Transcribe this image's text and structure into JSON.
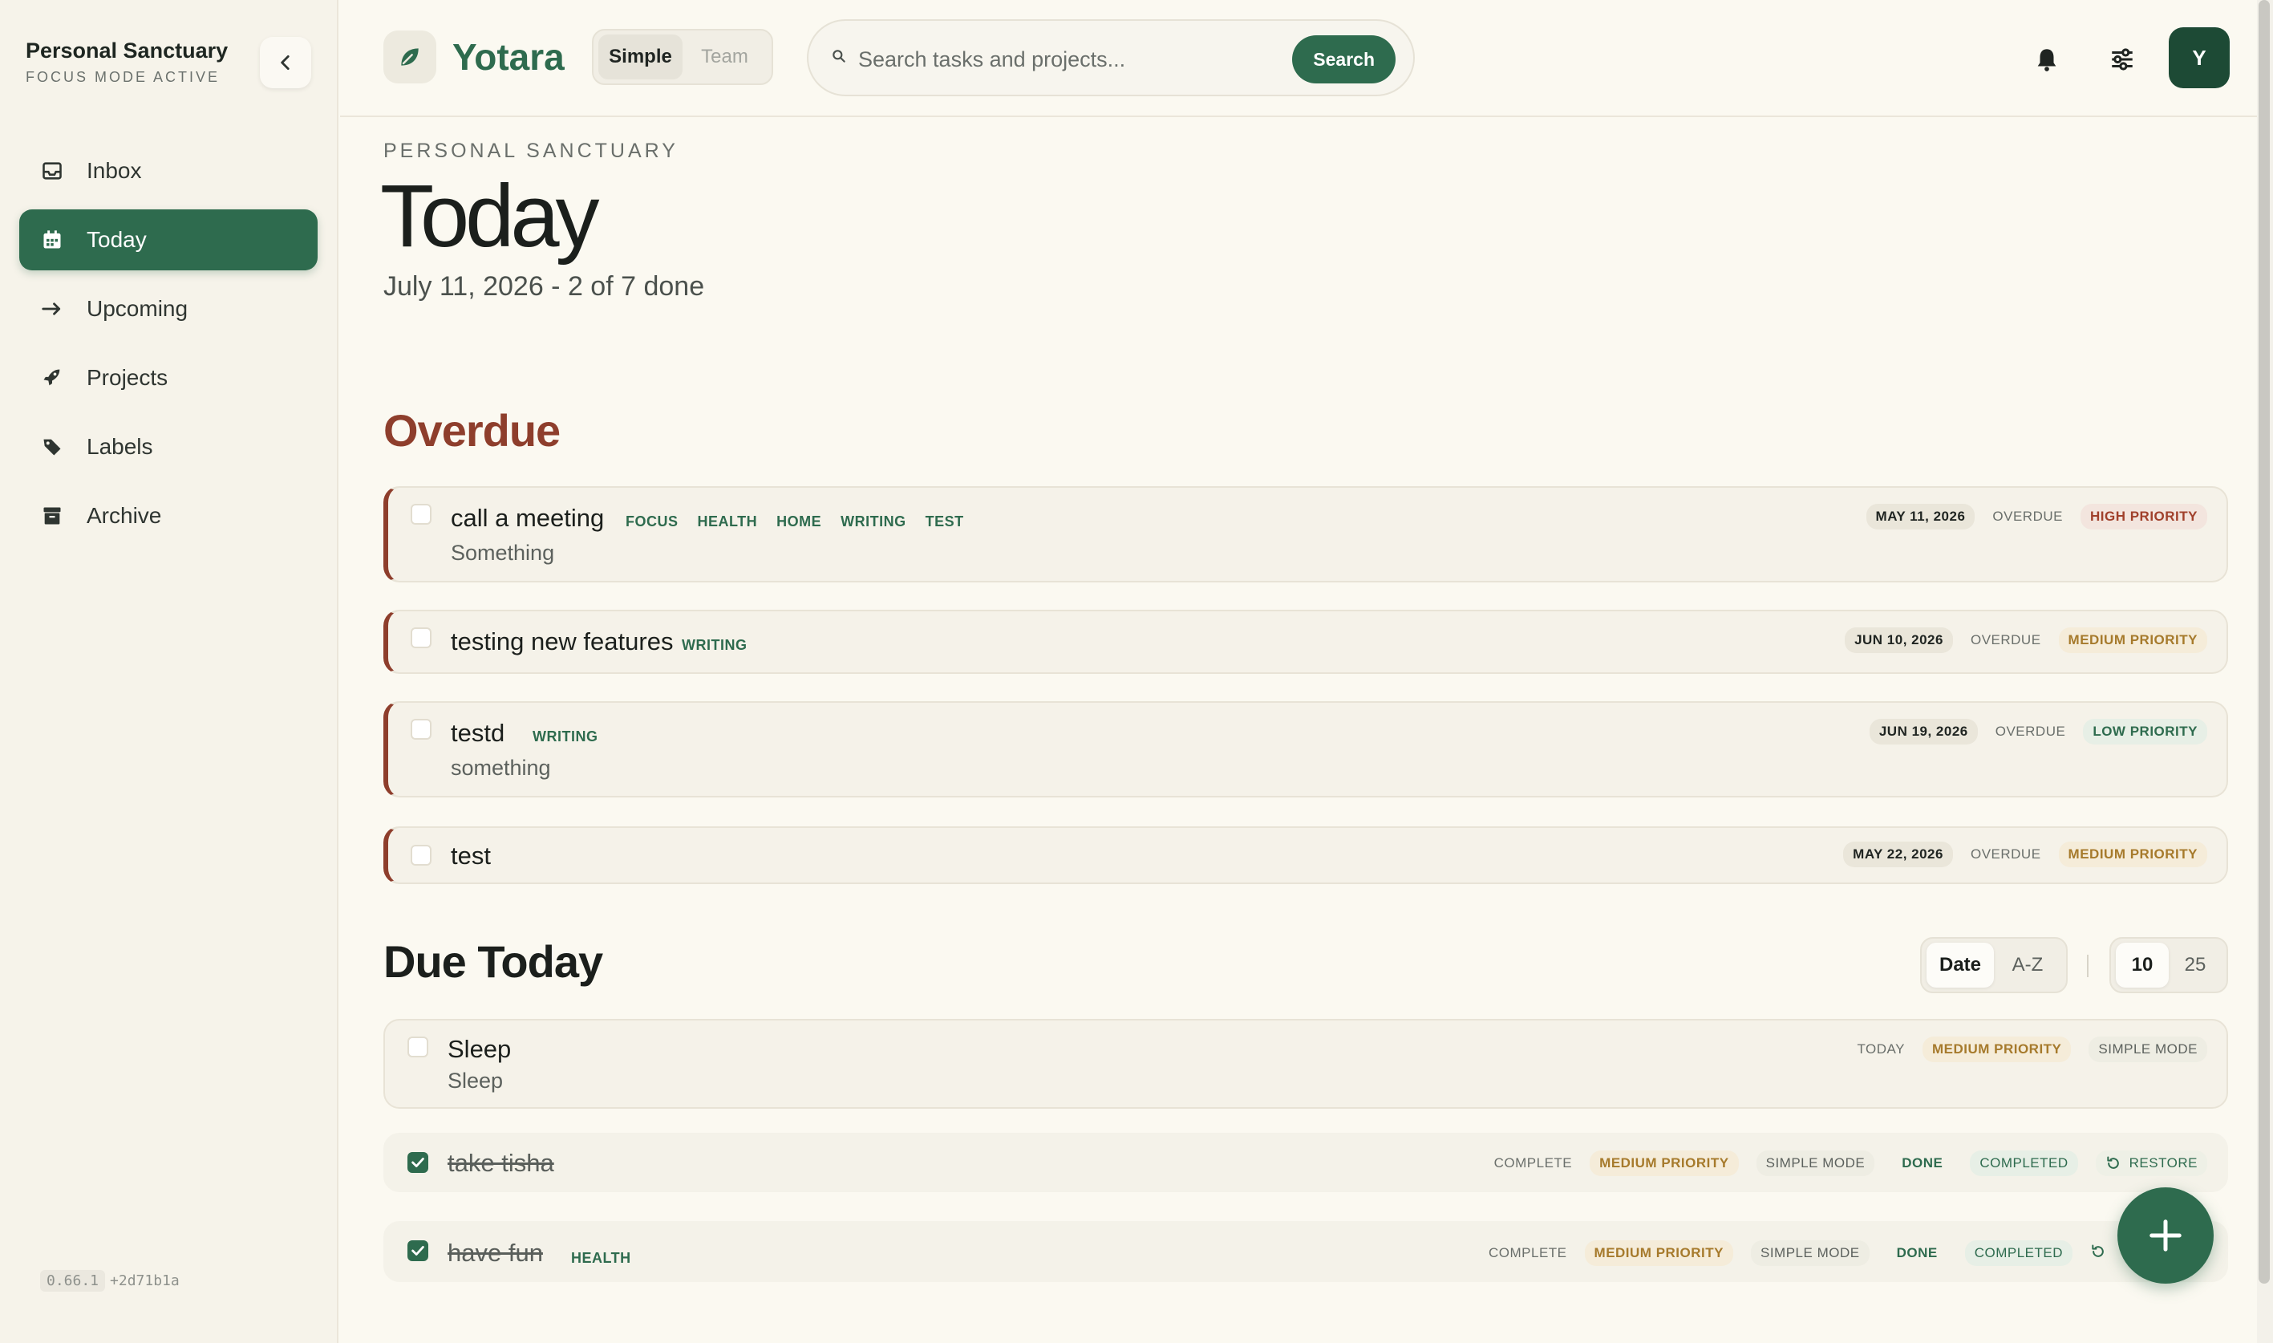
{
  "sidebar": {
    "title": "Personal Sanctuary",
    "subtitle": "FOCUS MODE ACTIVE",
    "nav": [
      {
        "label": "Inbox",
        "icon": "inbox-icon"
      },
      {
        "label": "Today",
        "icon": "calendar-icon",
        "active": true
      },
      {
        "label": "Upcoming",
        "icon": "arrow-right-icon"
      },
      {
        "label": "Projects",
        "icon": "rocket-icon"
      },
      {
        "label": "Labels",
        "icon": "tag-icon"
      },
      {
        "label": "Archive",
        "icon": "archive-icon"
      }
    ],
    "version": "0.66.1",
    "build": "+2d71b1a"
  },
  "topbar": {
    "logo": "Yotara",
    "mode_simple": "Simple",
    "mode_team": "Team",
    "search_placeholder": "Search tasks and projects...",
    "search_button": "Search",
    "avatar_initial": "Y"
  },
  "page": {
    "eyebrow": "PERSONAL SANCTUARY",
    "title": "Today",
    "date_summary": "July 11, 2026 - 2 of 7 done"
  },
  "overdue": {
    "title": "Overdue",
    "tasks": [
      {
        "title": "call a meeting",
        "note": "Something",
        "tags": [
          "FOCUS",
          "HEALTH",
          "HOME",
          "WRITING",
          "TEST"
        ],
        "date": "MAY 11, 2026",
        "status": "OVERDUE",
        "priority": "HIGH PRIORITY"
      },
      {
        "title": "testing new features",
        "tags": [
          "WRITING"
        ],
        "date": "JUN 10, 2026",
        "status": "OVERDUE",
        "priority": "MEDIUM PRIORITY"
      },
      {
        "title": "testd",
        "note": "something",
        "tags": [
          "WRITING"
        ],
        "date": "JUN 19, 2026",
        "status": "OVERDUE",
        "priority": "LOW PRIORITY"
      },
      {
        "title": "test",
        "date": "MAY 22, 2026",
        "status": "OVERDUE",
        "priority": "MEDIUM PRIORITY"
      }
    ]
  },
  "due_today": {
    "title": "Due Today",
    "sort_date": "Date",
    "sort_az": "A-Z",
    "size_10": "10",
    "size_25": "25",
    "tasks": [
      {
        "title": "Sleep",
        "note": "Sleep",
        "status": "TODAY",
        "priority": "MEDIUM PRIORITY",
        "mode": "SIMPLE MODE"
      },
      {
        "title": "take tisha",
        "status": "COMPLETE",
        "priority": "MEDIUM PRIORITY",
        "mode": "SIMPLE MODE",
        "done": "DONE",
        "completed": "COMPLETED",
        "restore": "RESTORE"
      },
      {
        "title": "have fun",
        "tags": [
          "HEALTH"
        ],
        "status": "COMPLETE",
        "priority": "MEDIUM PRIORITY",
        "mode": "SIMPLE MODE",
        "done": "DONE",
        "completed": "COMPLETED"
      }
    ]
  },
  "colors": {
    "accent": "#2e6b4e",
    "overdue": "#8e3e2c",
    "background": "#fbf9f1"
  }
}
